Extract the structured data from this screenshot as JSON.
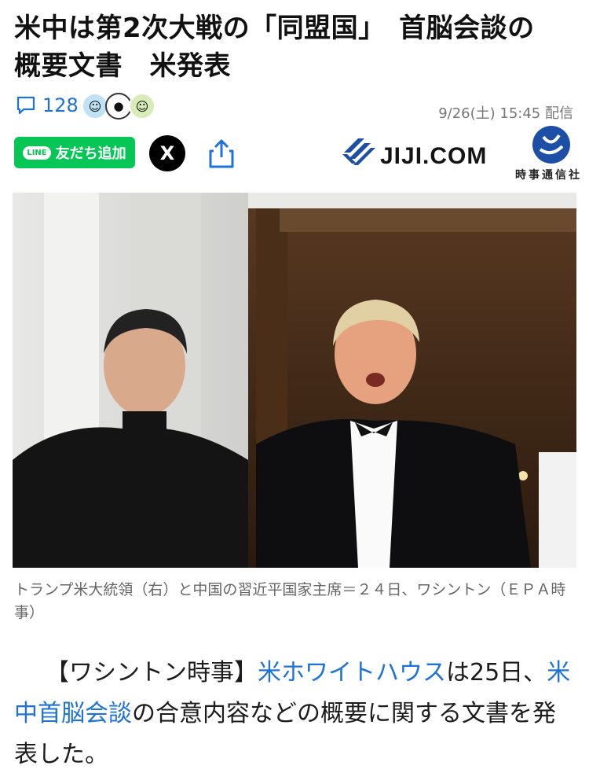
{
  "article": {
    "title_line1": "米中は第2次大戦の「同盟国」　首脳会談の",
    "title_line2": "概要文書　米発表",
    "comment_count": "128",
    "published": "9/26(土) 15:45 配信"
  },
  "share": {
    "line_badge": "LINE",
    "line_label": "友だち追加",
    "x_label": "X"
  },
  "source": {
    "name": "JIJI.COM",
    "subtitle": "時事通信社"
  },
  "photo": {
    "caption": "トランプ米大統領（右）と中国の習近平国家主席＝２４日、ワシントン（ＥＰＡ時事）"
  },
  "body": {
    "p1_a": "【ワシントン時事】",
    "p1_link1": "米ホワイトハウス",
    "p1_b": "は25日、",
    "p1_link2": "米中首脳会談",
    "p1_c": "の合意内容などの概要に関する文書を発表した。"
  },
  "icons": {
    "comment": "comment-icon",
    "share": "share-icon",
    "line": "line-icon",
    "x": "x-icon"
  },
  "colors": {
    "link": "#1e73d8",
    "line_green": "#06c755",
    "jiji_blue": "#1d4fa6"
  }
}
